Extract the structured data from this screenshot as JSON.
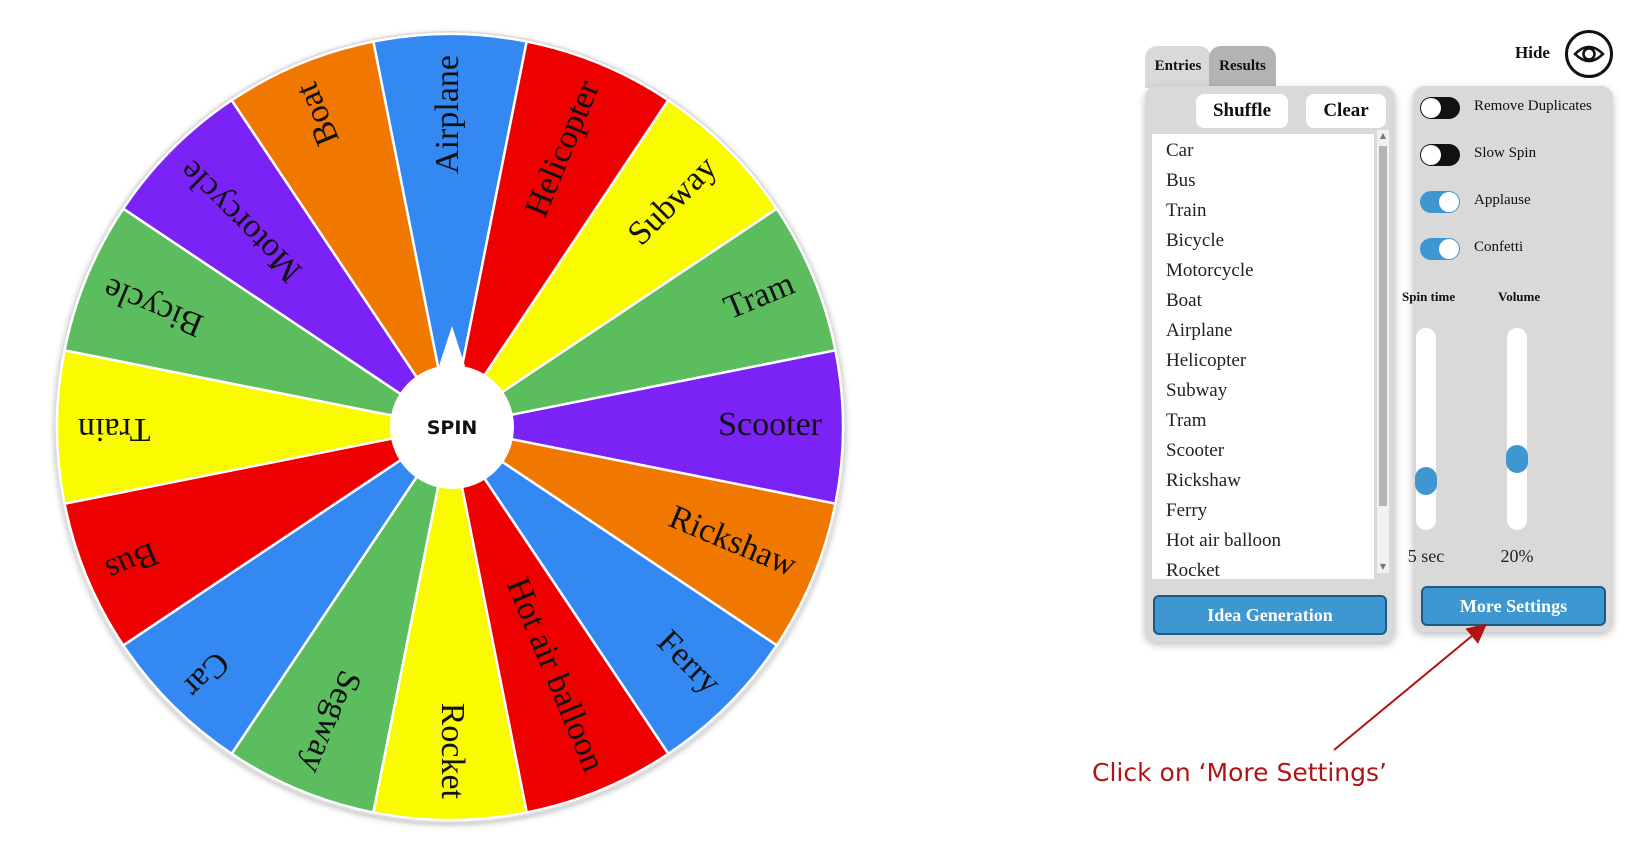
{
  "wheel": {
    "spin_label": "SPIN",
    "segments": [
      {
        "label": "Airplane",
        "color": "#3388f2"
      },
      {
        "label": "Helicopter",
        "color": "#ee0000"
      },
      {
        "label": "Subway",
        "color": "#fafa00"
      },
      {
        "label": "Tram",
        "color": "#5cbd5e"
      },
      {
        "label": "Scooter",
        "color": "#7b22f7"
      },
      {
        "label": "Rickshaw",
        "color": "#f07800"
      },
      {
        "label": "Ferry",
        "color": "#3388f2"
      },
      {
        "label": "Hot air balloon",
        "color": "#ee0000"
      },
      {
        "label": "Rocket",
        "color": "#fafa00"
      },
      {
        "label": "Segway",
        "color": "#5cbd5e"
      },
      {
        "label": "Car",
        "color": "#3388f2"
      },
      {
        "label": "Bus",
        "color": "#ee0000"
      },
      {
        "label": "Train",
        "color": "#fafa00"
      },
      {
        "label": "Bicycle",
        "color": "#5cbd5e"
      },
      {
        "label": "Motorcycle",
        "color": "#7b22f7"
      },
      {
        "label": "Boat",
        "color": "#f07800"
      }
    ]
  },
  "entries_panel": {
    "tabs": [
      "Entries",
      "Results"
    ],
    "shuffle_label": "Shuffle",
    "clear_label": "Clear",
    "entries": [
      "Car",
      "Bus",
      "Train",
      "Bicycle",
      "Motorcycle",
      "Boat",
      "Airplane",
      "Helicopter",
      "Subway",
      "Tram",
      "Scooter",
      "Rickshaw",
      "Ferry",
      "Hot air balloon",
      "Rocket"
    ],
    "idea_button": "Idea Generation"
  },
  "settings_panel": {
    "hide_label": "Hide",
    "toggles": [
      {
        "label": "Remove Duplicates",
        "on": false
      },
      {
        "label": "Slow Spin",
        "on": false
      },
      {
        "label": "Applause",
        "on": true
      },
      {
        "label": "Confetti",
        "on": true
      }
    ],
    "spin_time": {
      "title": "Spin time",
      "value": "5 sec",
      "level": 0.13
    },
    "volume": {
      "title": "Volume",
      "value": "20%",
      "level": 0.26
    },
    "more_settings": "More Settings"
  },
  "annotation": {
    "text": "Click on ‘More Settings’",
    "color": "#b01515"
  },
  "accent_color": "#3f97d2",
  "icons": [
    "eye-icon",
    "pointer-icon"
  ]
}
